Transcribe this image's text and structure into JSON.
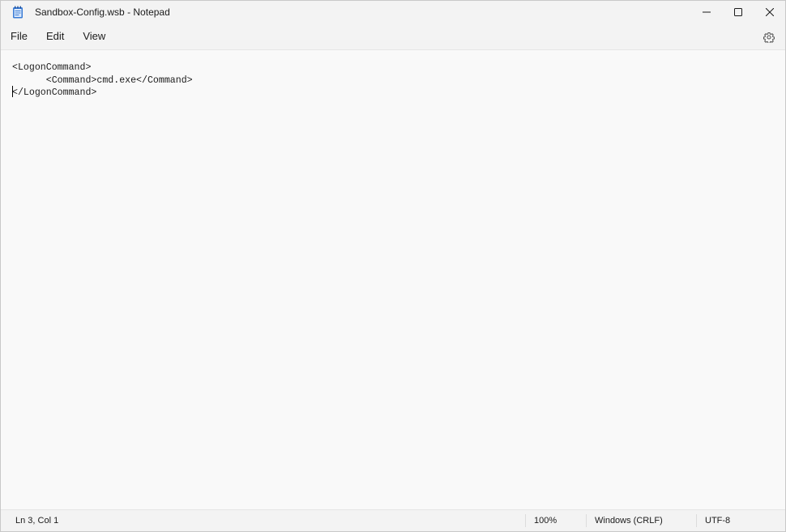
{
  "window": {
    "title": "Sandbox-Config.wsb - Notepad"
  },
  "menu": {
    "items": [
      "File",
      "Edit",
      "View"
    ]
  },
  "editor": {
    "lines": [
      "<LogonCommand>",
      "      <Command>cmd.exe</Command>",
      "</LogonCommand>"
    ]
  },
  "status": {
    "position": "Ln 3, Col 1",
    "zoom": "100%",
    "line_ending": "Windows (CRLF)",
    "encoding": "UTF-8"
  },
  "icons": {
    "app": "notepad-icon",
    "minimize": "minimize-icon",
    "maximize": "maximize-icon",
    "close": "close-icon",
    "settings": "gear-icon"
  },
  "colors": {
    "app_icon": "#3a7bd5",
    "background": "#f9f9f9",
    "chrome": "#f3f3f3"
  }
}
